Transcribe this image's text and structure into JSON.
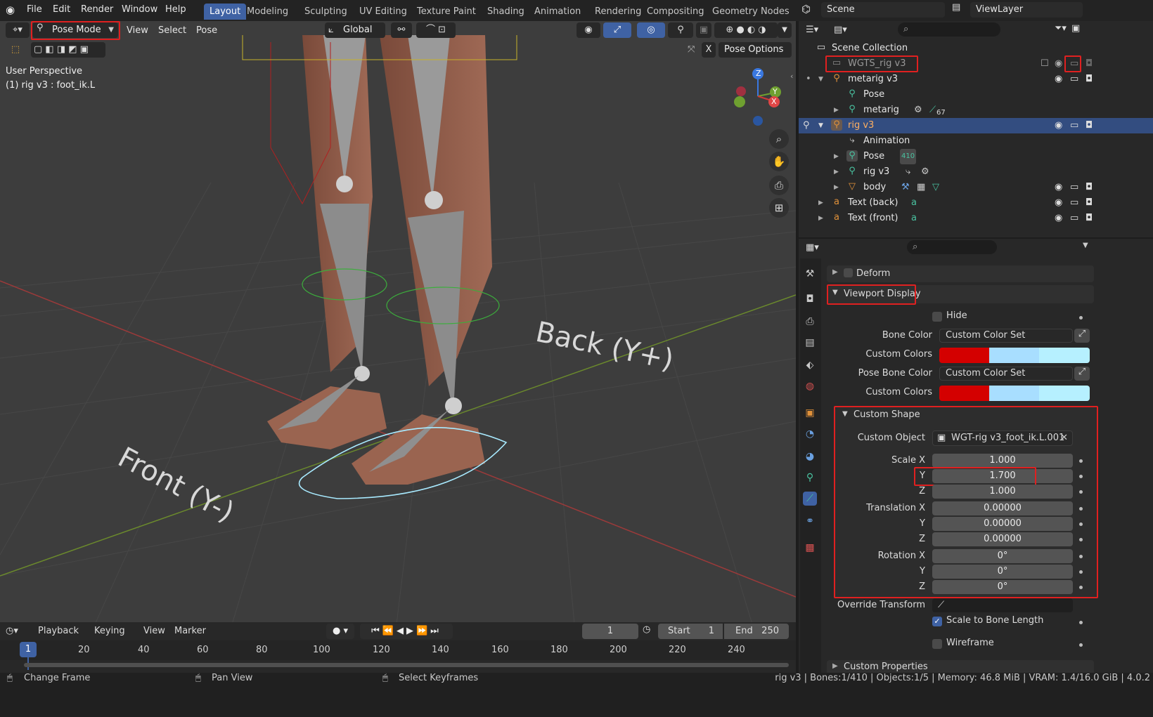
{
  "menu": {
    "file": "File",
    "edit": "Edit",
    "render": "Render",
    "window": "Window",
    "help": "Help"
  },
  "workspaces": [
    "Layout",
    "Modeling",
    "Sculpting",
    "UV Editing",
    "Texture Paint",
    "Shading",
    "Animation",
    "Rendering",
    "Compositing",
    "Geometry Nodes"
  ],
  "scene": {
    "name": "Scene",
    "view_layer": "ViewLayer"
  },
  "viewport": {
    "mode": "Pose Mode",
    "menu_view": "View",
    "menu_select": "Select",
    "menu_pose": "Pose",
    "transform_orientation": "Global",
    "pose_options": "Pose Options",
    "x_toggle": "X",
    "overlay_title": "User Perspective",
    "overlay_subtitle": "(1) rig v3 : foot_ik.L",
    "text_back": "Back (Y+)",
    "text_front": "Front (Y-)",
    "axis_z": "Z",
    "axis_y": "Y",
    "axis_x": "X"
  },
  "outliner": {
    "root": "Scene Collection",
    "rows": [
      {
        "label": "WGTS_rig v3"
      },
      {
        "label": "metarig v3"
      },
      {
        "label": "Pose"
      },
      {
        "label": "metarig",
        "badge": "67"
      },
      {
        "label": "rig v3"
      },
      {
        "label": "Animation"
      },
      {
        "label": "Pose",
        "badge": "410"
      },
      {
        "label": "rig v3"
      },
      {
        "label": "body"
      },
      {
        "label": "Text (back)"
      },
      {
        "label": "Text (front)"
      }
    ]
  },
  "properties": {
    "deform": "Deform",
    "viewport_display": "Viewport Display",
    "hide": "Hide",
    "bone_color_label": "Bone Color",
    "bone_color_value": "Custom Color Set",
    "custom_colors_label": "Custom Colors",
    "pose_bone_color_label": "Pose Bone Color",
    "pose_bone_color_value": "Custom Color Set",
    "custom_colors_label2": "Custom Colors",
    "colors": {
      "normal": "#d40000",
      "select": "#a8deff",
      "active": "#b6f0ff"
    },
    "custom_shape": "Custom Shape",
    "custom_object_label": "Custom Object",
    "custom_object_value": "WGT-rig v3_foot_ik.L.001",
    "scale_x_label": "Scale X",
    "scale_x": "1.000",
    "scale_y_label": "Y",
    "scale_y": "1.700",
    "scale_z_label": "Z",
    "scale_z": "1.000",
    "trans_x_label": "Translation X",
    "trans_x": "0.00000",
    "trans_y_label": "Y",
    "trans_y": "0.00000",
    "trans_z_label": "Z",
    "trans_z": "0.00000",
    "rot_x_label": "Rotation X",
    "rot_x": "0°",
    "rot_y_label": "Y",
    "rot_y": "0°",
    "rot_z_label": "Z",
    "rot_z": "0°",
    "override_transform": "Override Transform",
    "scale_to_bone_length": "Scale to Bone Length",
    "wireframe": "Wireframe",
    "custom_properties": "Custom Properties"
  },
  "timeline": {
    "playback": "Playback",
    "keying": "Keying",
    "view": "View",
    "marker": "Marker",
    "current_frame": "1",
    "start_label": "Start",
    "start": "1",
    "end_label": "End",
    "end": "250",
    "ticks": [
      "1",
      "20",
      "40",
      "60",
      "80",
      "100",
      "120",
      "140",
      "160",
      "180",
      "200",
      "220",
      "240"
    ]
  },
  "status": {
    "change_frame": "Change Frame",
    "pan_view": "Pan View",
    "select_keyframes": "Select Keyframes",
    "info": "rig v3 | Bones:1/410 | Objects:1/5 | Memory: 46.8 MiB | VRAM: 1.4/16.0 GiB | 4.0.2"
  }
}
